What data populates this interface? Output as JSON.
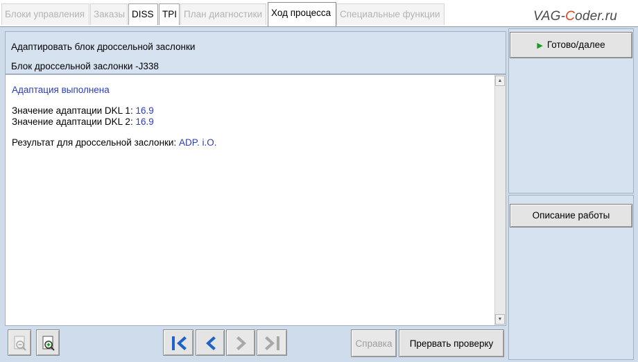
{
  "tabs": [
    {
      "label": "Блоки управления",
      "state": "disabled"
    },
    {
      "label": "Заказы",
      "state": "disabled"
    },
    {
      "label": "DISS",
      "state": "enabled"
    },
    {
      "label": "TPI",
      "state": "enabled"
    },
    {
      "label": "План диагностики",
      "state": "disabled"
    },
    {
      "label": "Ход процесса",
      "state": "active"
    },
    {
      "label": "Специальные функции",
      "state": "disabled"
    }
  ],
  "watermark": {
    "part1": "VAG-",
    "part2": "C",
    "part3": "oder.ru"
  },
  "header": {
    "title": "Адаптировать блок дроссельной заслонки",
    "subtitle": "Блок дроссельной заслонки -J338"
  },
  "content": {
    "status": "Адаптация выполнена",
    "dkl1_label": "Значение адаптации DKL 1: ",
    "dkl1_value": "16.9",
    "dkl2_label": "Значение адаптации DKL 2: ",
    "dkl2_value": "16.9",
    "result_label": "Результат для дроссельной заслонки: ",
    "result_value": "ADP. i.O."
  },
  "right_panel": {
    "next_button": "Готово/далее",
    "description_button": "Описание работы"
  },
  "toolbar": {
    "help_button": "Справка",
    "abort_button": "Прервать проверку"
  },
  "colors": {
    "accent_blue": "#2a3bbd",
    "panel_bg": "#cfdcec",
    "nav_icon": "#1f63c8",
    "play_green": "#1a9a2a"
  }
}
